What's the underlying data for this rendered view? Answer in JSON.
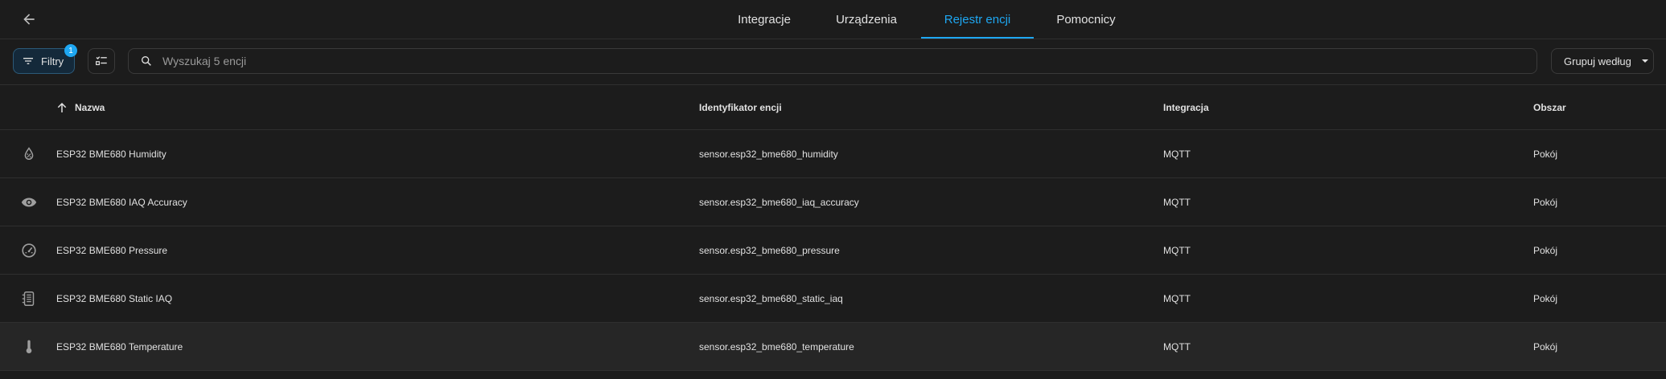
{
  "nav": {
    "back_icon": "arrow-left-icon",
    "tabs": [
      {
        "label": "Integracje"
      },
      {
        "label": "Urządzenia"
      },
      {
        "label": "Rejestr encji",
        "active": true
      },
      {
        "label": "Pomocnicy"
      }
    ]
  },
  "toolbar": {
    "filter_label": "Filtry",
    "filter_badge": "1",
    "search_placeholder": "Wyszukaj 5 encji",
    "group_label": "Grupuj według"
  },
  "table": {
    "columns": [
      "Nazwa",
      "Identyfikator encji",
      "Integracja",
      "Obszar"
    ],
    "sort_icon": "arrow-up-icon",
    "rows": [
      {
        "icon": "water-percent-icon",
        "name": "ESP32 BME680 Humidity",
        "entity_id": "sensor.esp32_bme680_humidity",
        "integration": "MQTT",
        "area": "Pokój"
      },
      {
        "icon": "eye-icon",
        "name": "ESP32 BME680 IAQ Accuracy",
        "entity_id": "sensor.esp32_bme680_iaq_accuracy",
        "integration": "MQTT",
        "area": "Pokój"
      },
      {
        "icon": "gauge-icon",
        "name": "ESP32 BME680 Pressure",
        "entity_id": "sensor.esp32_bme680_pressure",
        "integration": "MQTT",
        "area": "Pokój"
      },
      {
        "icon": "air-filter-icon",
        "name": "ESP32 BME680 Static IAQ",
        "entity_id": "sensor.esp32_bme680_static_iaq",
        "integration": "MQTT",
        "area": "Pokój"
      },
      {
        "icon": "thermometer-icon",
        "name": "ESP32 BME680 Temperature",
        "entity_id": "sensor.esp32_bme680_temperature",
        "integration": "MQTT",
        "area": "Pokój"
      }
    ]
  },
  "colors": {
    "accent": "#1ea7f2",
    "background": "#1c1c1c",
    "text": "#e1e1e1"
  }
}
